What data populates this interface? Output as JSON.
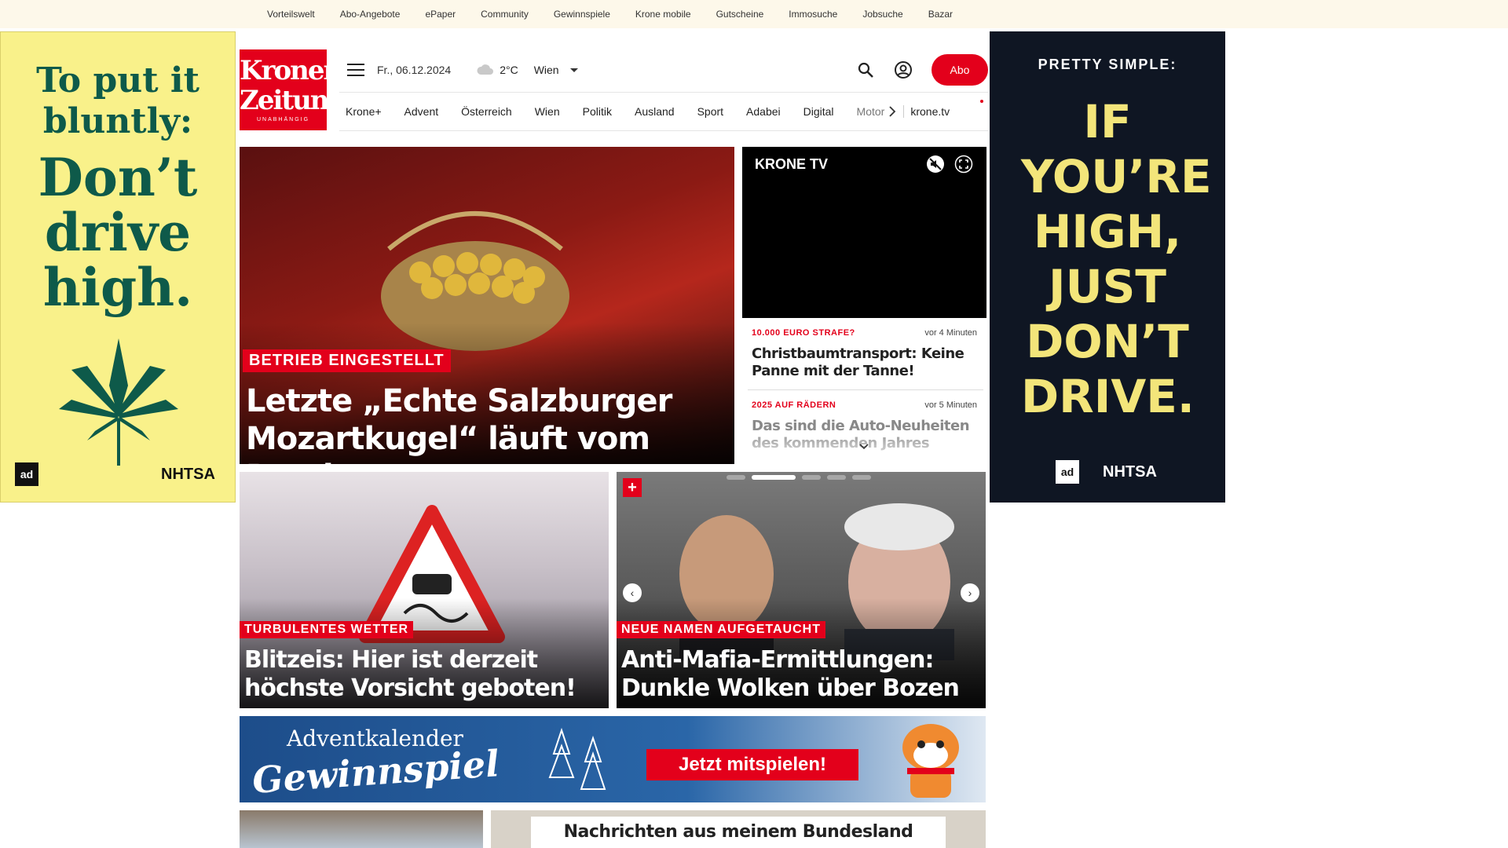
{
  "topbar": {
    "links": [
      "Vorteilswelt",
      "Abo-Angebote",
      "ePaper",
      "Community",
      "Gewinnspiele",
      "Krone mobile",
      "Gutscheine",
      "Immosuche",
      "Jobsuche",
      "Bazar"
    ]
  },
  "ad_left": {
    "line1": "To put it bluntly:",
    "line2": "Don’t drive high.",
    "logo_ad": "ad",
    "logo_nhtsa": "NHTSA"
  },
  "ad_right": {
    "line1": "PRETTY SIMPLE:",
    "line2": "IF YOU’RE HIGH, JUST DON’T DRIVE.",
    "logo_ad": "ad",
    "logo_nhtsa": "NHTSA"
  },
  "logo": {
    "word1": "Kronen",
    "word2": "Zeitung",
    "tagline": "UNABHÄNGIG"
  },
  "header": {
    "date": "Fr., 06.12.2024",
    "temperature": "2°C",
    "city": "Wien",
    "abo_label": "Abo"
  },
  "nav": {
    "items": [
      "Krone+",
      "Advent",
      "Österreich",
      "Wien",
      "Politik",
      "Ausland",
      "Sport",
      "Adabei",
      "Digital",
      "Motor"
    ],
    "tv": "krone.tv"
  },
  "hero": {
    "kicker": "BETRIEB EINGESTELLT",
    "headline": "Letzte „Echte Salzburger Mozartkugel“ läuft vom Band"
  },
  "video": {
    "brand": "KRONE TV"
  },
  "ticker": [
    {
      "category": "10.000 EURO STRAFE?",
      "time": "vor 4 Minuten",
      "title": "Christbaumtransport: Keine Panne mit der Tanne!"
    },
    {
      "category": "2025 AUF RÄDERN",
      "time": "vor 5 Minuten",
      "title": "Das sind die Auto-Neuheiten des kommenden Jahres"
    }
  ],
  "cards": [
    {
      "kicker": "TURBULENTES WETTER",
      "headline": "Blitzeis: Hier ist derzeit höchste Vorsicht geboten!"
    },
    {
      "kicker": "NEUE NAMEN AUFGETAUCHT",
      "headline": "Anti-Mafia-Ermittlungen: Dunkle Wolken über Bozen",
      "plus": "+"
    }
  ],
  "banner": {
    "line1": "Adventkalender",
    "line2": "Gewinnspiel",
    "cta": "Jetzt mitspielen!"
  },
  "bundesland": "Nachrichten aus meinem Bundesland",
  "colors": {
    "brand": "#e3001b",
    "ad_left_bg": "#f9f18a",
    "ad_right_bg": "#0f1623"
  }
}
